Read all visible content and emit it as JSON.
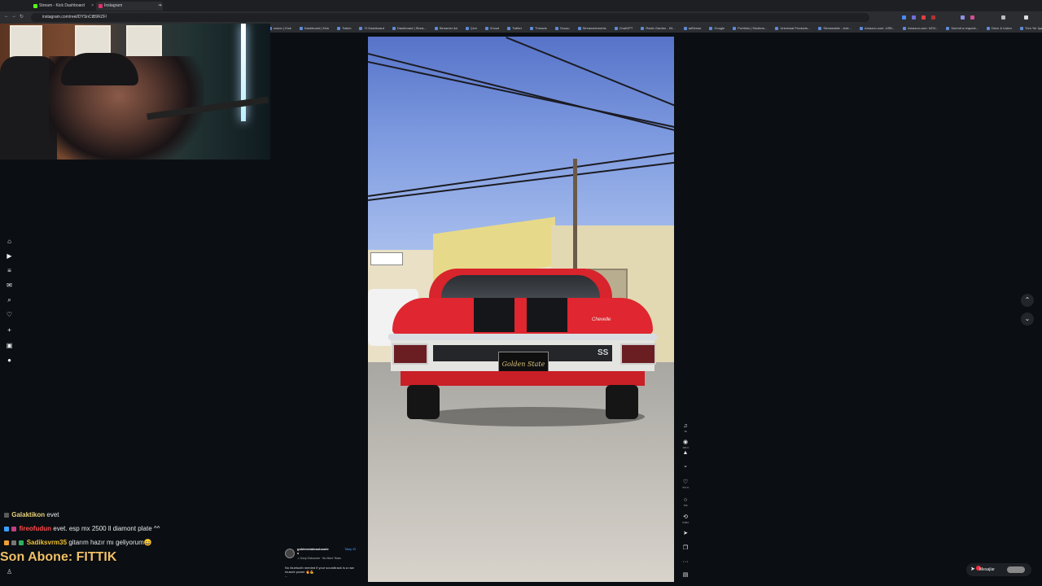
{
  "browser": {
    "tabs": [
      {
        "label": "Stream - Kick Dashboard",
        "color": "#53fc18"
      },
      {
        "label": "Instagram",
        "color": "#e1306c"
      }
    ],
    "url": "instagram.com/reel/DYSnCtB9RZF/",
    "bookmarks": [
      "owner | Kick",
      "Dashboard | Kick",
      "Twitch",
      "Yt Dashboard",
      "Dashboard | Strea...",
      "Streamer Ad",
      "Çevi",
      "iCloud",
      "Twitter",
      "Threads",
      "Ocuuu",
      "Streamelements",
      "ChatGPT",
      "Radio Garden - Kli...",
      "adSense",
      "Google",
      "Portfolio | Shutters...",
      "Universal Products...",
      "Streamable - vide...",
      "Amazon.com: USB...",
      "Amazon.com: NOV...",
      "Submit a request...",
      "Drive & Listen",
      "Tüm Yer İşaretleri"
    ]
  },
  "sidenav": {
    "items": [
      {
        "name": "home-icon",
        "glyph": "⌂"
      },
      {
        "name": "reels-icon",
        "glyph": "▶"
      },
      {
        "name": "explore-icon",
        "glyph": "≡"
      },
      {
        "name": "messages-icon",
        "glyph": "✉"
      },
      {
        "name": "search-icon",
        "glyph": "⌕"
      },
      {
        "name": "notifications-icon",
        "glyph": "♡"
      },
      {
        "name": "create-icon",
        "glyph": "+"
      },
      {
        "name": "dashboard-icon",
        "glyph": "▣"
      },
      {
        "name": "profile-icon",
        "glyph": "●"
      }
    ]
  },
  "reel": {
    "plate_text": "Golden State",
    "badge_text": "SS",
    "script_text": "Chevelle"
  },
  "rail": {
    "items": [
      {
        "name": "audio-icon",
        "glyph": "♫",
        "count": "16"
      },
      {
        "name": "views-icon",
        "glyph": "◉",
        "count": "100.3"
      },
      {
        "name": "trending-icon",
        "glyph": "▲",
        "count": ""
      },
      {
        "name": "chevron-down-icon",
        "glyph": "⌄",
        "count": ""
      },
      {
        "name": "like-icon",
        "glyph": "♡",
        "count": "371.9"
      },
      {
        "name": "comment-icon",
        "glyph": "○",
        "count": "762"
      },
      {
        "name": "repost-icon",
        "glyph": "⟲",
        "count": "5,844"
      },
      {
        "name": "share-icon",
        "glyph": "➤",
        "count": ""
      },
      {
        "name": "save-icon",
        "glyph": "❐",
        "count": ""
      },
      {
        "name": "more-icon",
        "glyph": "···",
        "count": ""
      },
      {
        "name": "audio-thumb-icon",
        "glyph": "▤",
        "count": ""
      }
    ]
  },
  "caption": {
    "username": "goldenstateautosale",
    "username_wrap": "s",
    "follow": "Takip Et",
    "song": "♫ Ozzy Osbourne · No More Tears",
    "text": "No bluetooth needed if your soundtrack is a raw muscle power 🔥💪",
    "more": "..."
  },
  "messages": {
    "label": "Mesajlar"
  },
  "chat": {
    "lines": [
      {
        "user": "Galaktikon",
        "text": "evet",
        "user_color": "#e8d27a"
      },
      {
        "user": "fireofudun",
        "text": "evet. esp mx 2500 ll diamont plate ^^",
        "user_color": "#ff4a4a"
      },
      {
        "user": "Sadiksvrm35",
        "text": "gitarım hazır mı geliyorum😄",
        "user_color": "#f0c030"
      }
    ],
    "sub_label": "Son Abone: FITTIK"
  }
}
